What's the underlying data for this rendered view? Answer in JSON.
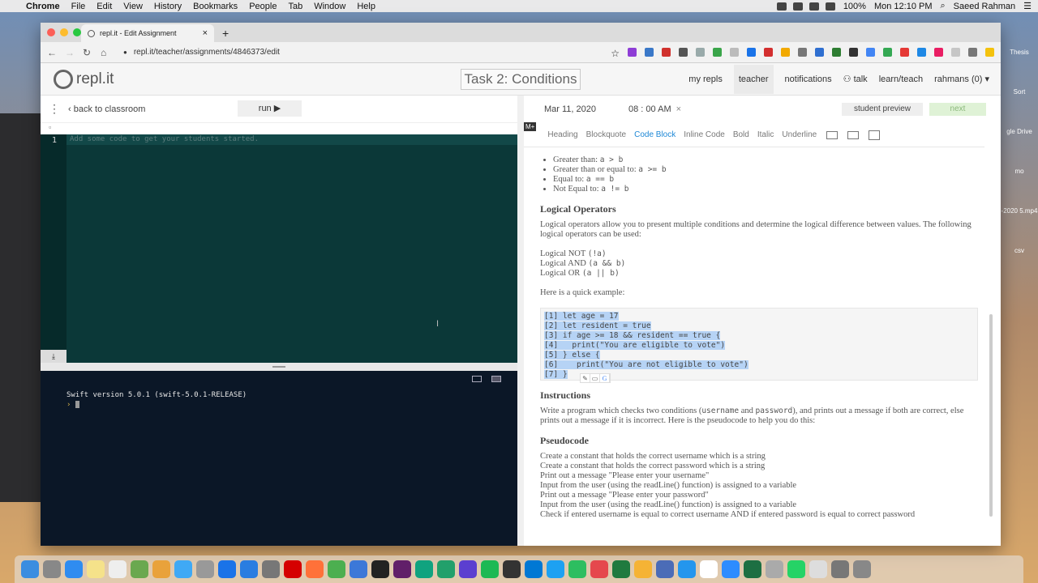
{
  "menubar": {
    "app": "Chrome",
    "items": [
      "File",
      "Edit",
      "View",
      "History",
      "Bookmarks",
      "People",
      "Tab",
      "Window",
      "Help"
    ],
    "battery": "100%",
    "clock": "Mon 12:10 PM",
    "user": "Saeed Rahman"
  },
  "desktop": {
    "labels": [
      "Thesis",
      "Sort",
      "gle Drive",
      "mo",
      "-2020\n5.mp4",
      "csv"
    ]
  },
  "browser": {
    "tab_title": "repl.it - Edit Assignment",
    "tab_close": "×",
    "new_tab": "+",
    "url": "repl.it/teacher/assignments/4846373/edit"
  },
  "header": {
    "logo": "repl.it",
    "task_name": "Task 2: Conditions",
    "nav": [
      "my repls",
      "teacher",
      "notifications",
      "talk",
      "learn/teach",
      "rahmans (0) ▾"
    ]
  },
  "editor": {
    "back": "back to classroom",
    "run": "run ▶",
    "line_number": "1",
    "placeholder": "Add some code to get your students started."
  },
  "console": {
    "version": "Swift version 5.0.1 (swift-5.0.1-RELEASE)",
    "prompt": "›"
  },
  "assignment": {
    "date": "Mar 11, 2020",
    "time": "08 : 00 AM",
    "clear": "×",
    "preview": "student preview",
    "next": "next"
  },
  "toolbar": {
    "badge": "M+",
    "buttons": [
      "Heading",
      "Blockquote",
      "Code Block",
      "Inline Code",
      "Bold",
      "Italic",
      "Underline"
    ],
    "active": "Code Block"
  },
  "doc": {
    "operators": [
      {
        "label": "Greater than: ",
        "code": "a > b"
      },
      {
        "label": "Greater than or equal to: ",
        "code": "a >= b"
      },
      {
        "label": "Equal to: ",
        "code": "a == b"
      },
      {
        "label": "Not Equal to: ",
        "code": "a != b"
      }
    ],
    "h_logical": "Logical Operators",
    "p_logical": "Logical operators allow you to present multiple conditions and determine the logical difference between values. The following logical operators can be used:",
    "logical": [
      {
        "label": "Logical NOT ",
        "code": "(!a)"
      },
      {
        "label": "Logical AND ",
        "code": "(a && b)"
      },
      {
        "label": "Logical OR ",
        "code": "(a || b)"
      }
    ],
    "p_example": "Here is a quick example:",
    "code_lines": [
      "[1] let age = 17",
      "[2] let resident = true",
      "[3] if age >= 18 && resident == true {",
      "[4]   print(\"You are eligible to vote\")",
      "[5] } else {",
      "[6]    print(\"You are not eligible to vote\")",
      "[7] }"
    ],
    "h_instr": "Instructions",
    "p_instr_1": "Write a program which checks two conditions (",
    "p_instr_c1": "username",
    "p_instr_2": " and ",
    "p_instr_c2": "password",
    "p_instr_3": "), and prints out a message if both are correct, else prints out a message if it is incorrect. Here is the pseudocode to help you do this:",
    "h_pseudo": "Pseudocode",
    "pseudo": [
      "Create a constant that holds the correct username which is a string",
      "Create a constant that holds the correct password which is a string",
      "Print out a message \"Please enter your username\"",
      "Input from the user (using the readLine() function) is assigned to a variable",
      "Print out a message \"Please enter your password\"",
      "Input from the user (using the readLine() function) is assigned to a variable",
      "Check if entered username is equal to correct username AND if entered password is equal to correct password"
    ]
  },
  "colors": {
    "editor_bg": "#0b3838",
    "console_bg": "#0b1727",
    "accent": "#1e88d6",
    "next_bg": "#dff2d6"
  }
}
